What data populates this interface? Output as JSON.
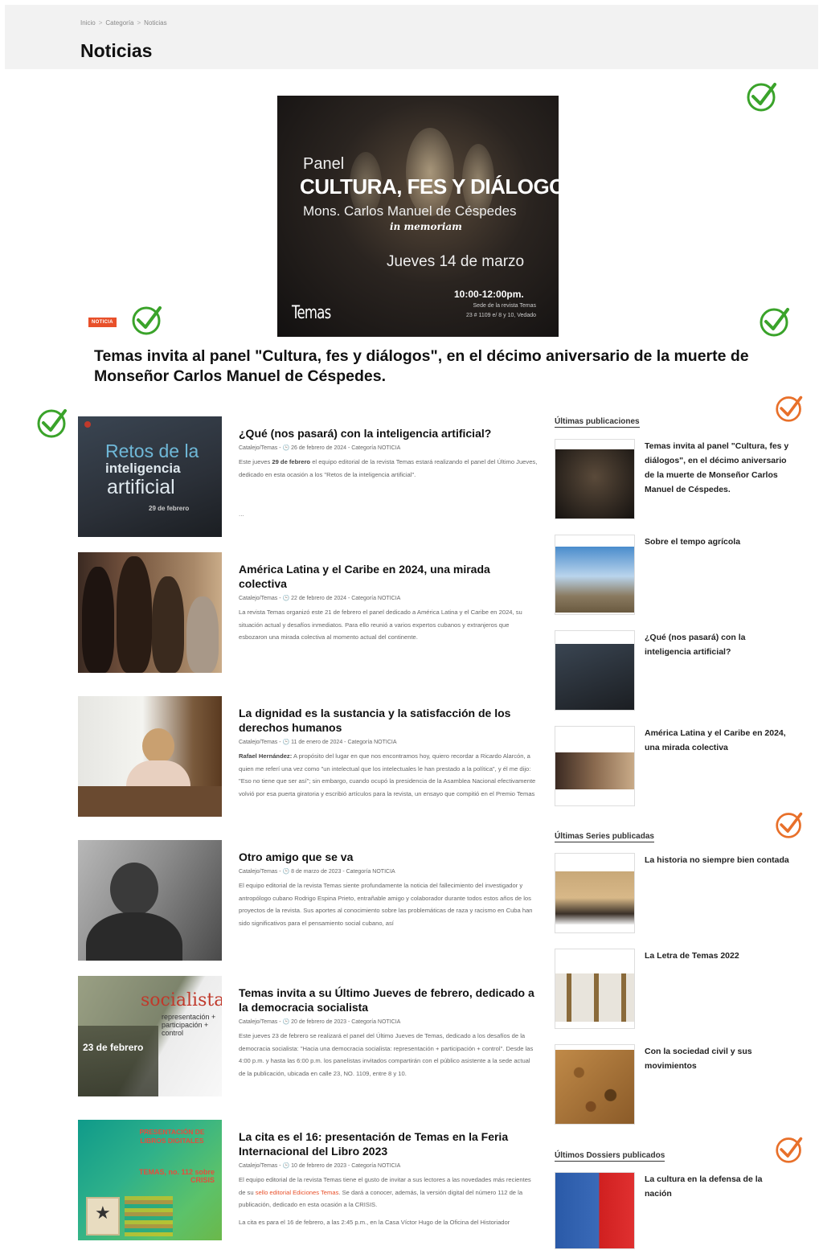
{
  "breadcrumb": [
    "Inicio",
    "Categoría",
    "Noticias"
  ],
  "page_title": "Noticias",
  "featured": {
    "image": {
      "pretitle": "Panel",
      "title": "CULTURA, FES Y DIÁLOGOS",
      "subtitle": "Mons. Carlos Manuel de Céspedes",
      "memoriam": "in memoriam",
      "date": "Jueves 14 de marzo",
      "time": "10:00-12:00pm.",
      "venue_line1": "Sede de la revista Temas",
      "venue_line2": "23 # 1109 e/ 8 y 10, Vedado",
      "logo": "Temas"
    },
    "badge": "NOTICIA",
    "headline": "Temas invita al panel \"Cultura, fes y diálogos\", en el décimo aniversario de la muerte de Monseñor Carlos Manuel de Céspedes."
  },
  "articles": [
    {
      "title": "¿Qué (nos pasará) con la inteligencia artificial?",
      "meta": "Catalejo/Temas - 🕒 26 de febrero de 2024 - Categoría NOTICIA",
      "excerpt_pre": "Este jueves ",
      "excerpt_bold": "29 de febrero",
      "excerpt_post": " el equipo editorial de la revista Temas estará realizando el panel del Último Jueves, dedicado en esta ocasión a los \"Retos de la inteligencia artificial\".",
      "more": "...",
      "thumb": {
        "l1": "Retos de la",
        "l2": "inteligencia",
        "l3": "artificial",
        "l4": "29 de febrero"
      }
    },
    {
      "title": "América Latina y el Caribe en 2024, una mirada colectiva",
      "meta": "Catalejo/Temas - 🕒 22 de febrero de 2024 - Categoría NOTICIA",
      "excerpt": "La revista Temas organizó este 21 de febrero el panel dedicado a América Latina y el Caribe en 2024, su situación actual y desafíos inmediatos. Para ello reunió a varios expertos cubanos y extranjeros que esbozaron una mirada colectiva al momento actual del continente."
    },
    {
      "title": "La dignidad es la sustancia y la satisfacción de los derechos humanos",
      "meta": "Catalejo/Temas - 🕒 11 de enero de 2024 - Categoría NOTICIA",
      "excerpt_bold": "Rafael Hernández:",
      "excerpt_post": " A propósito del lugar en que nos encontramos hoy, quiero recordar a Ricardo Alarcón, a quien me referí una vez como \"un intelectual que los intelectuales le han prestado a la política\", y él me dijo: \"Eso no tiene que ser así\"; sin embargo, cuando ocupó la presidencia de la Asamblea Nacional efectivamente volvió por esa puerta giratoria y escribió artículos para la revista, un ensayo que compitió en el Premio Temas de Ensayo y..."
    },
    {
      "title": "Otro amigo que se va",
      "meta": "Catalejo/Temas - 🕒 8 de marzo de 2023 - Categoría NOTICIA",
      "excerpt": "El equipo editorial de la revista Temas siente profundamente la noticia del fallecimiento del investigador y antropólogo cubano Rodrigo Espina Prieto, entrañable amigo y colaborador durante todos estos años de los proyectos de la revista. Sus aportes al conocimiento sobre las problemáticas de raza y racismo en Cuba han sido significativos para el pensamiento social cubano, así"
    },
    {
      "title": "Temas invita a su Último Jueves de febrero, dedicado a la democracia socialista",
      "meta": "Catalejo/Temas - 🕒 20 de febrero de 2023 - Categoría NOTICIA",
      "excerpt": "Este jueves 23 de febrero se realizará el panel del Último Jueves de Temas, dedicado a los desafíos de la democracia socialista: \"Hacia una democracia socialista: representación + participación + control\". Desde las 4:00 p.m. y hasta las 6:00 p.m. los panelistas invitados compartirán con el público asistente a la sede actual de la publicación, ubicada en calle 23, NO. 1109, entre 8 y 10.",
      "thumb": {
        "l1": "socialista:",
        "l2": "representación + participación + control",
        "l3": "23 de febrero"
      }
    },
    {
      "title": "La cita es el 16: presentación de Temas en la Feria Internacional del Libro 2023",
      "meta": "Catalejo/Temas - 🕒 10 de febrero de 2023 - Categoría NOTICIA",
      "excerpt_pre": "El equipo editorial de la revista Temas tiene el gusto de invitar a sus lectores a las novedades más recientes de su ",
      "excerpt_link": "sello editorial Ediciones Temas",
      "excerpt_post": ". Se dará a conocer, además, la versión digital del número 112 de la publicación, dedicado en esta ocasión a la CRISIS.",
      "excerpt2": "La cita es para el 16 de febrero, a las 2:45 p.m., en la Casa Víctor Hugo de la Oficina del Historiador",
      "thumb": {
        "l1": "PRESENTACIÓN DE LIBROS DIGITALES",
        "l2": "TEMAS, no. 112 sobre CRISIS"
      }
    }
  ],
  "sidebar": {
    "latest_title": "Últimas publicaciones",
    "latest": [
      "Temas invita al panel \"Cultura, fes y diálogos\", en el décimo aniversario de la muerte de Monseñor Carlos Manuel de Céspedes.",
      "Sobre el tempo agrícola",
      "¿Qué (nos pasará) con la inteligencia artificial?",
      "América Latina y el Caribe en 2024, una mirada colectiva"
    ],
    "series_title": "Últimas Series publicadas",
    "series": [
      "La historia no siempre bien contada",
      "La Letra de Temas 2022",
      "Con la sociedad civil y sus movimientos"
    ],
    "dossiers_title": "Últimos Dossiers publicados",
    "dossiers": [
      "La cultura en la defensa de la nación"
    ]
  },
  "colors": {
    "accent": "#e8502a",
    "check_green": "#3aa32a",
    "check_orange": "#e8702a"
  },
  "icons": [
    "check-icon"
  ]
}
